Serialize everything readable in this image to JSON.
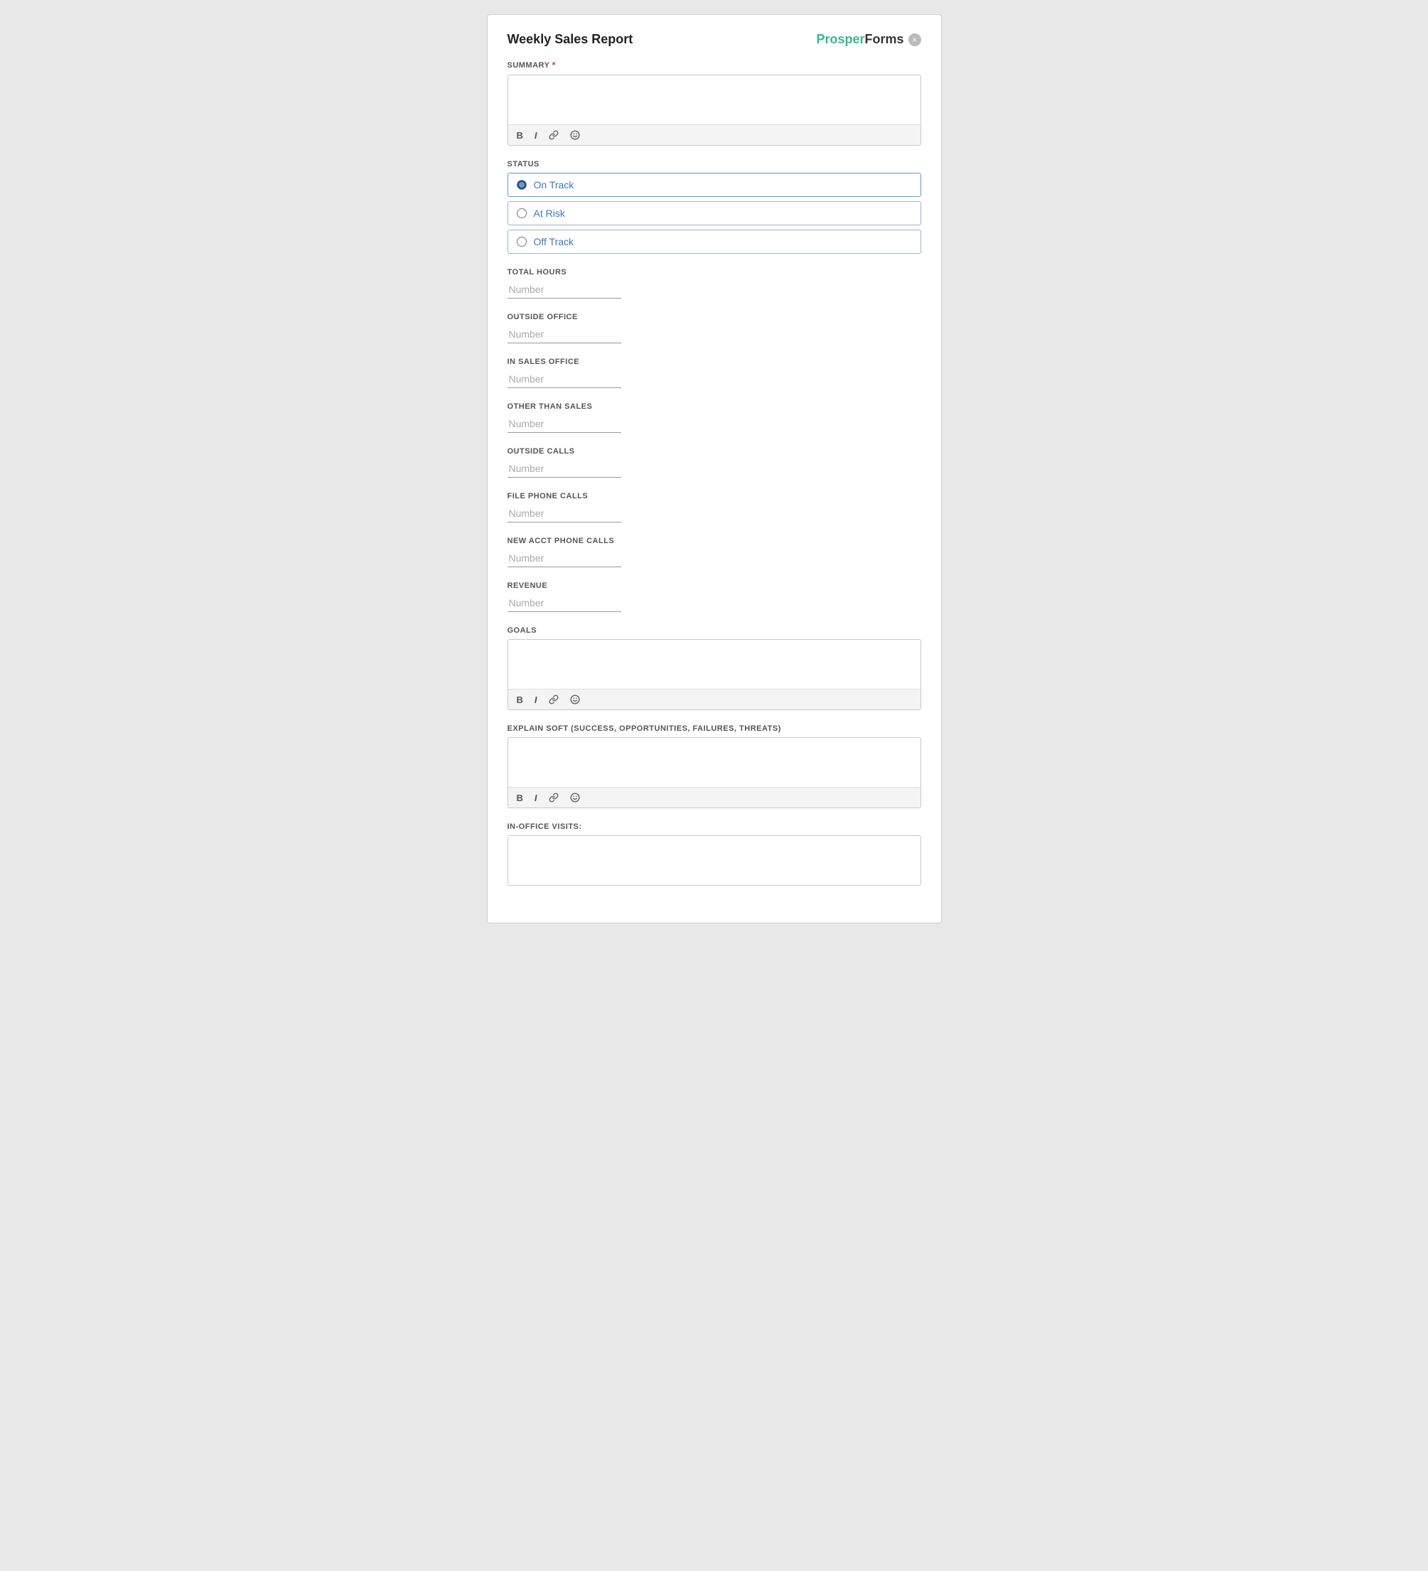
{
  "header": {
    "title": "Weekly Sales Report",
    "brand_prosper": "Prosper",
    "brand_forms": "Forms",
    "close_label": "×"
  },
  "fields": {
    "summary": {
      "label": "SUMMARY",
      "required": true,
      "placeholder": "",
      "toolbar": {
        "bold": "B",
        "italic": "I",
        "link": "🔗",
        "emoji": "🙂"
      }
    },
    "status": {
      "label": "STATUS",
      "options": [
        {
          "id": "on-track",
          "label": "On Track",
          "selected": true
        },
        {
          "id": "at-risk",
          "label": "At Risk",
          "selected": false
        },
        {
          "id": "off-track",
          "label": "Off Track",
          "selected": false
        }
      ]
    },
    "total_hours": {
      "label": "TOTAL HOURS",
      "placeholder": "Number"
    },
    "outside_office": {
      "label": "OUTSIDE OFFICE",
      "placeholder": "Number"
    },
    "in_sales_office": {
      "label": "IN SALES OFFICE",
      "placeholder": "Number"
    },
    "other_than_sales": {
      "label": "OTHER THAN SALES",
      "placeholder": "Number"
    },
    "outside_calls": {
      "label": "OUTSIDE CALLS",
      "placeholder": "Number"
    },
    "file_phone_calls": {
      "label": "FILE PHONE CALLS",
      "placeholder": "Number"
    },
    "new_acct_phone_calls": {
      "label": "NEW ACCT PHONE CALLS",
      "placeholder": "Number"
    },
    "revenue": {
      "label": "REVENUE",
      "placeholder": "Number"
    },
    "goals": {
      "label": "GOALS",
      "placeholder": "",
      "toolbar": {
        "bold": "B",
        "italic": "I",
        "link": "🔗",
        "emoji": "🙂"
      }
    },
    "explain_soft": {
      "label": "EXPLAIN SOFT (SUCCESS, OPPORTUNITIES, FAILURES, THREATS)",
      "placeholder": "",
      "toolbar": {
        "bold": "B",
        "italic": "I",
        "link": "🔗",
        "emoji": "🙂"
      }
    },
    "in_office_visits": {
      "label": "IN-OFFICE VISITS:",
      "placeholder": ""
    }
  }
}
